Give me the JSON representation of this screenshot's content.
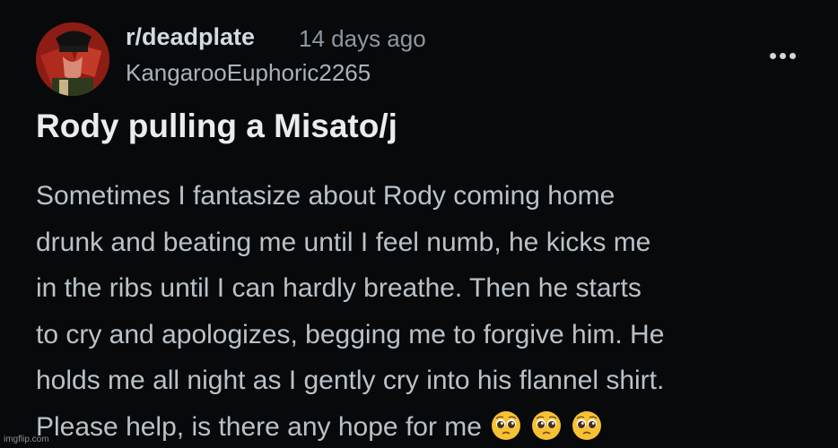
{
  "post": {
    "subreddit": "r/deadplate",
    "timestamp": "14 days ago",
    "username": "KangarooEuphoric2265",
    "title": "Rody pulling a Misato/j",
    "body_lines": [
      "Sometimes I fantasize about Rody coming home",
      "drunk and beating me until I feel numb, he kicks me",
      "in the ribs until I can hardly breathe. Then he starts",
      "to cry and apologizes, begging me to forgive him. He",
      "holds me all night as I gently cry into his flannel shirt.",
      "Please help, is there any hope for me"
    ],
    "emojis": [
      "pleading-face-emoji",
      "pleading-face-emoji",
      "pleading-face-emoji"
    ]
  },
  "icons": {
    "more": "more-options-icon",
    "avatar": "user-avatar"
  },
  "watermark": "imgflip.com",
  "colors": {
    "background": "#07090b",
    "subreddit": "#d3dbe2",
    "meta": "#8e989f",
    "title": "#e9edf0",
    "body": "#b9c2c9",
    "emoji": "#f6c233"
  }
}
